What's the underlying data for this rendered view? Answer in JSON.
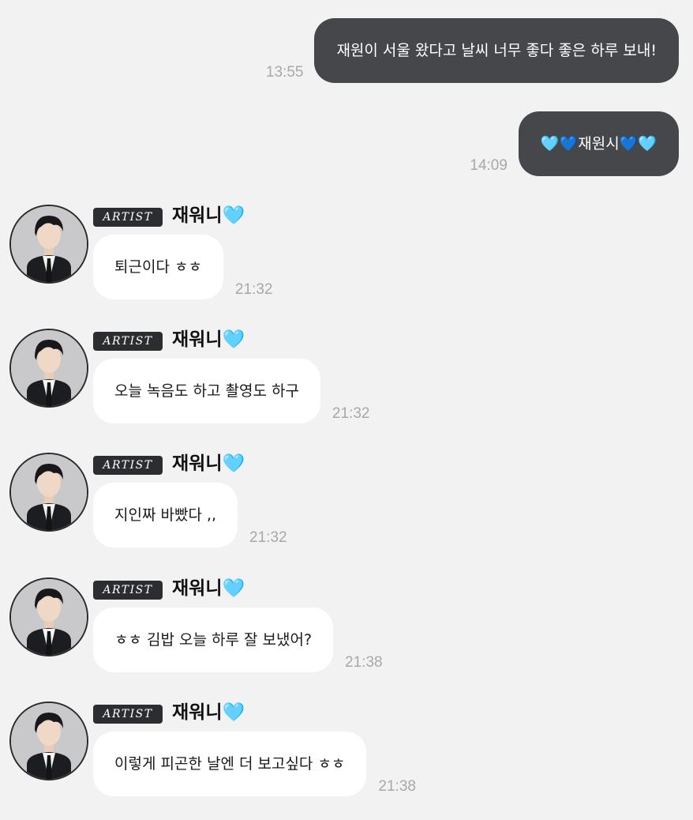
{
  "sent": [
    {
      "text": "재원이 서울 왔다고 날씨 너무 좋다 좋은 하루 보내!",
      "time": "13:55"
    },
    {
      "text": "🩵💙재원시💙🩵",
      "time": "14:09"
    }
  ],
  "artist": {
    "badge": "ARTIST",
    "name": "재워니",
    "heart": "🩵"
  },
  "received": [
    {
      "text": "퇴근이다 ㅎㅎ",
      "time": "21:32"
    },
    {
      "text": "오늘 녹음도 하고 촬영도 하구",
      "time": "21:32"
    },
    {
      "text": "지인짜 바빴다 ,,",
      "time": "21:32"
    },
    {
      "text": "ㅎㅎ 김밥 오늘 하루 잘 보냈어?",
      "time": "21:38"
    },
    {
      "text": "이렇게 피곤한 날엔 더 보고싶다 ㅎㅎ",
      "time": "21:38"
    }
  ],
  "colors": {
    "background": "#f2f2f2",
    "sent_bubble": "#46474b",
    "received_bubble": "#ffffff",
    "timestamp": "#a8a8a8",
    "badge": "#2b2d30"
  },
  "icons": {
    "avatar": "artist-profile-photo",
    "heart": "light-blue-heart-emoji"
  }
}
